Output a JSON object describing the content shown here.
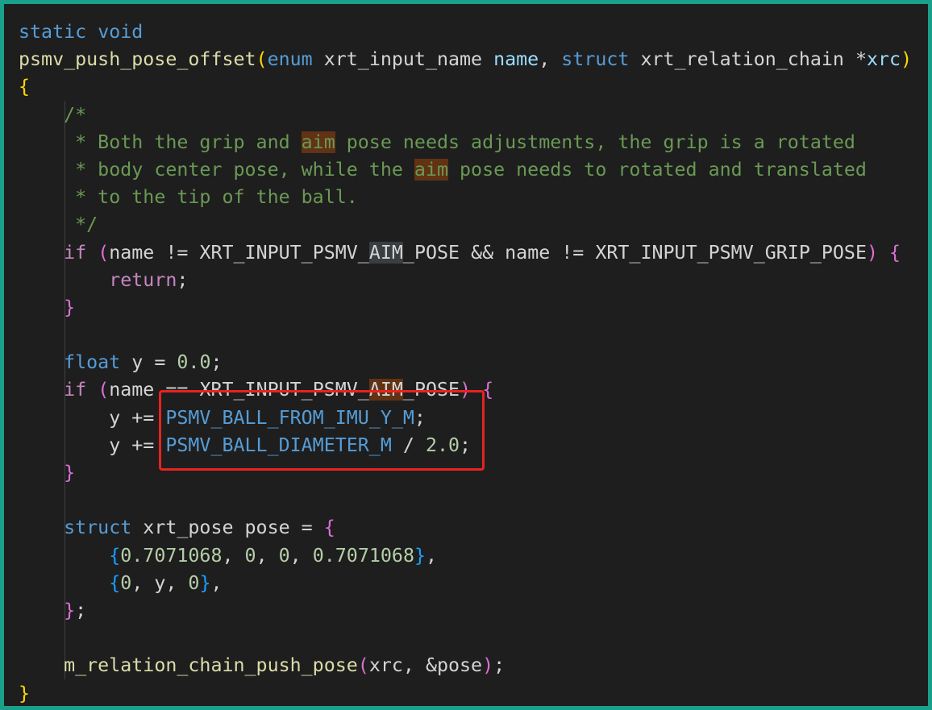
{
  "code": {
    "lines": [
      [
        {
          "t": "static",
          "c": "kw"
        },
        {
          "t": " ",
          "c": "plain"
        },
        {
          "t": "void",
          "c": "kw"
        }
      ],
      [
        {
          "t": "psmv_push_pose_offset",
          "c": "fn"
        },
        {
          "t": "(",
          "c": "b1"
        },
        {
          "t": "enum",
          "c": "kw"
        },
        {
          "t": " xrt_input_name ",
          "c": "plain"
        },
        {
          "t": "name",
          "c": "var"
        },
        {
          "t": ", ",
          "c": "plain"
        },
        {
          "t": "struct",
          "c": "kw"
        },
        {
          "t": " xrt_relation_chain ",
          "c": "plain"
        },
        {
          "t": "*",
          "c": "plain"
        },
        {
          "t": "xrc",
          "c": "var"
        },
        {
          "t": ")",
          "c": "b1"
        }
      ],
      [
        {
          "t": "{",
          "c": "b1"
        }
      ],
      [
        {
          "t": "    ",
          "c": "plain"
        },
        {
          "t": "/*",
          "c": "cmt"
        }
      ],
      [
        {
          "t": "    ",
          "c": "plain"
        },
        {
          "t": " * Both the grip and ",
          "c": "cmt"
        },
        {
          "t": "aim",
          "c": "cmt",
          "h": "word"
        },
        {
          "t": " pose needs adjustments, the grip is a rotated",
          "c": "cmt"
        }
      ],
      [
        {
          "t": "    ",
          "c": "plain"
        },
        {
          "t": " * body center pose, while the ",
          "c": "cmt"
        },
        {
          "t": "aim",
          "c": "cmt",
          "h": "word"
        },
        {
          "t": " pose needs to rotated and translated",
          "c": "cmt"
        }
      ],
      [
        {
          "t": "    ",
          "c": "plain"
        },
        {
          "t": " * to the tip of the ball.",
          "c": "cmt"
        }
      ],
      [
        {
          "t": "    ",
          "c": "plain"
        },
        {
          "t": " */",
          "c": "cmt"
        }
      ],
      [
        {
          "t": "    ",
          "c": "plain"
        },
        {
          "t": "if",
          "c": "ctl"
        },
        {
          "t": " ",
          "c": "plain"
        },
        {
          "t": "(",
          "c": "b2"
        },
        {
          "t": "name != XRT_INPUT_PSMV_",
          "c": "plain"
        },
        {
          "t": "AIM",
          "c": "plain",
          "h": "sel"
        },
        {
          "t": "_POSE && name != XRT_INPUT_PSMV_GRIP_POSE",
          "c": "plain"
        },
        {
          "t": ")",
          "c": "b2"
        },
        {
          "t": " ",
          "c": "plain"
        },
        {
          "t": "{",
          "c": "b2"
        }
      ],
      [
        {
          "t": "        ",
          "c": "plain"
        },
        {
          "t": "return",
          "c": "ctl"
        },
        {
          "t": ";",
          "c": "plain"
        }
      ],
      [
        {
          "t": "    ",
          "c": "plain"
        },
        {
          "t": "}",
          "c": "b2"
        }
      ],
      [],
      [
        {
          "t": "    ",
          "c": "plain"
        },
        {
          "t": "float",
          "c": "kw"
        },
        {
          "t": " y = ",
          "c": "plain"
        },
        {
          "t": "0.0",
          "c": "num"
        },
        {
          "t": ";",
          "c": "plain"
        }
      ],
      [
        {
          "t": "    ",
          "c": "plain"
        },
        {
          "t": "if",
          "c": "ctl"
        },
        {
          "t": " ",
          "c": "plain"
        },
        {
          "t": "(",
          "c": "b2"
        },
        {
          "t": "name == XRT_INPUT_PSMV_",
          "c": "plain"
        },
        {
          "t": "AIM",
          "c": "plain",
          "h": "word"
        },
        {
          "t": "_POSE",
          "c": "plain"
        },
        {
          "t": ")",
          "c": "b2"
        },
        {
          "t": " ",
          "c": "plain"
        },
        {
          "t": "{",
          "c": "b2"
        }
      ],
      [
        {
          "t": "        y += ",
          "c": "plain"
        },
        {
          "t": "PSMV_BALL_FROM_IMU_Y_M",
          "c": "mac"
        },
        {
          "t": ";",
          "c": "plain"
        }
      ],
      [
        {
          "t": "        y += ",
          "c": "plain"
        },
        {
          "t": "PSMV_BALL_DIAMETER_M",
          "c": "mac"
        },
        {
          "t": " / ",
          "c": "plain"
        },
        {
          "t": "2.0",
          "c": "num"
        },
        {
          "t": ";",
          "c": "plain"
        }
      ],
      [
        {
          "t": "    ",
          "c": "plain"
        },
        {
          "t": "}",
          "c": "b2"
        }
      ],
      [],
      [
        {
          "t": "    ",
          "c": "plain"
        },
        {
          "t": "struct",
          "c": "kw"
        },
        {
          "t": " xrt_pose pose = ",
          "c": "plain"
        },
        {
          "t": "{",
          "c": "b2"
        }
      ],
      [
        {
          "t": "        ",
          "c": "plain"
        },
        {
          "t": "{",
          "c": "b3"
        },
        {
          "t": "0.7071068",
          "c": "num"
        },
        {
          "t": ", ",
          "c": "plain"
        },
        {
          "t": "0",
          "c": "num"
        },
        {
          "t": ", ",
          "c": "plain"
        },
        {
          "t": "0",
          "c": "num"
        },
        {
          "t": ", ",
          "c": "plain"
        },
        {
          "t": "0.7071068",
          "c": "num"
        },
        {
          "t": "}",
          "c": "b3"
        },
        {
          "t": ",",
          "c": "plain"
        }
      ],
      [
        {
          "t": "        ",
          "c": "plain"
        },
        {
          "t": "{",
          "c": "b3"
        },
        {
          "t": "0",
          "c": "num"
        },
        {
          "t": ", y, ",
          "c": "plain"
        },
        {
          "t": "0",
          "c": "num"
        },
        {
          "t": "}",
          "c": "b3"
        },
        {
          "t": ",",
          "c": "plain"
        }
      ],
      [
        {
          "t": "    ",
          "c": "plain"
        },
        {
          "t": "}",
          "c": "b2"
        },
        {
          "t": ";",
          "c": "plain"
        }
      ],
      [],
      [
        {
          "t": "    ",
          "c": "plain"
        },
        {
          "t": "m_relation_chain_push_pose",
          "c": "fn"
        },
        {
          "t": "(",
          "c": "b2"
        },
        {
          "t": "xrc, &pose",
          "c": "plain"
        },
        {
          "t": ")",
          "c": "b2"
        },
        {
          "t": ";",
          "c": "plain"
        }
      ],
      [
        {
          "t": "}",
          "c": "b1"
        }
      ]
    ]
  },
  "colors": {
    "frame_border": "#1aa08a",
    "background": "#1e1e1e",
    "annotation_box": "#e8231f"
  }
}
